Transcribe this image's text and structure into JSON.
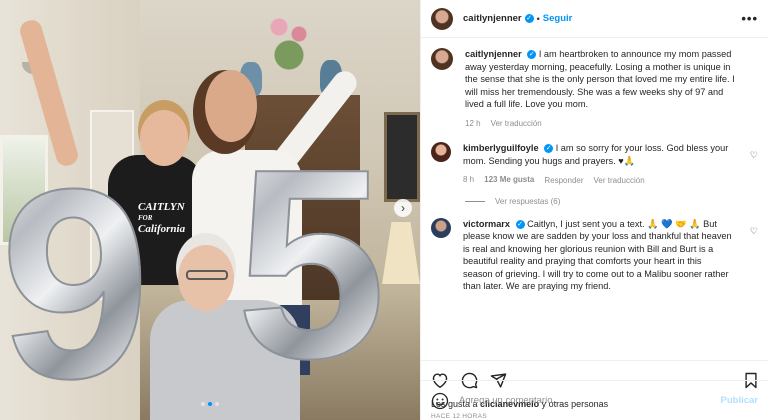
{
  "photo": {
    "shirt_line1": "CAITLYN",
    "shirt_line2": "FOR",
    "shirt_line3": "California",
    "balloon_left": "9",
    "balloon_right": "5",
    "carousel_total": 3,
    "carousel_active": 1
  },
  "header": {
    "username": "caitlynjenner",
    "separator": "•",
    "follow_label": "Seguir",
    "more_label": "•••"
  },
  "caption": {
    "username": "caitlynjenner",
    "text": "I am heartbroken to announce my mom passed away yesterday morning, peacefully. Losing a mother is unique in the sense that she is the only person that loved me my entire life. I will miss her tremendously. She was a few weeks shy of 97 and lived a full life. Love you mom.",
    "time": "12 h",
    "translate_label": "Ver traducción"
  },
  "comments": [
    {
      "username": "kimberlyguilfoyle",
      "text": "I am so sorry for your loss. God bless your mom. Sending you hugs and prayers. ♥🙏",
      "time": "8 h",
      "likes": "123 Me gusta",
      "reply_label": "Responder",
      "translate_label": "Ver traducción",
      "view_replies": "Ver respuestas (6)"
    },
    {
      "username": "victormarx",
      "text": "Caitlyn, I just sent you a text. 🙏 💙 🤝 🙏 But please know we are sadden by your loss and thankful that heaven is real and knowing her glorious reunion with Bill and Burt is a beautiful reality and praying that comforts your heart in this season of grieving. I will try to come out to a Malibu sooner rather than later. We are praying my friend."
    }
  ],
  "actions": {
    "likes_prefix": "Les gusta a ",
    "likes_user": "clicianevmelo",
    "likes_suffix": " y otras personas",
    "time_ago": "HACE 12 HORAS"
  },
  "add_comment": {
    "placeholder": "Agrega un comentario...",
    "publish_label": "Publicar"
  },
  "colors": {
    "accent": "#0095f6",
    "publish_disabled": "#b2dffc",
    "muted_text": "#8e8e8e"
  }
}
